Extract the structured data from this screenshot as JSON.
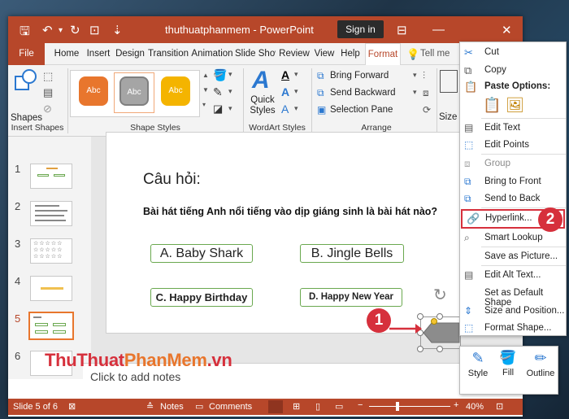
{
  "window": {
    "title": "thuthuatphanmem  -  PowerPoint",
    "sign_in": "Sign in"
  },
  "tabs": [
    "File",
    "Home",
    "Insert",
    "Design",
    "Transition",
    "Animation",
    "Slide Show",
    "Review",
    "View",
    "Help",
    "Format"
  ],
  "tell_me": "Tell me",
  "ribbon": {
    "shapes_label": "Shapes",
    "insert_shapes_group": "Insert Shapes",
    "style_swatch_text": "Abc",
    "shape_styles_group": "Shape Styles",
    "quick_styles_label": "Quick Styles",
    "wordart_group": "WordArt Styles",
    "bring_forward": "Bring Forward",
    "send_backward": "Send Backward",
    "selection_pane": "Selection Pane",
    "arrange_group": "Arrange",
    "size_label": "Size"
  },
  "thumbnails": [
    "1",
    "2",
    "3",
    "4",
    "5",
    "6"
  ],
  "slide": {
    "heading": "Câu hỏi:",
    "question": "Bài hát tiếng Anh nổi tiếng vào dịp giáng sinh là bài hát nào?",
    "answer_a": "A. Baby Shark",
    "answer_b": "B. Jingle Bells",
    "answer_c": "C. Happy Birthday",
    "answer_d": "D. Happy New Year"
  },
  "notes_placeholder": "Click to add notes",
  "status": {
    "slide_counter": "Slide 5 of 6",
    "notes": "Notes",
    "comments": "Comments",
    "zoom": "40%"
  },
  "context_menu": {
    "items": [
      {
        "label": "Cut",
        "disabled": false
      },
      {
        "label": "Copy",
        "disabled": false
      },
      {
        "label": "Paste Options:",
        "disabled": false
      },
      {
        "label": "Edit Text",
        "disabled": false
      },
      {
        "label": "Edit Points",
        "disabled": false
      },
      {
        "label": "Group",
        "disabled": true
      },
      {
        "label": "Bring to Front",
        "disabled": false
      },
      {
        "label": "Send to Back",
        "disabled": false
      },
      {
        "label": "Hyperlink...",
        "disabled": false
      },
      {
        "label": "Smart Lookup",
        "disabled": false
      },
      {
        "label": "Save as Picture...",
        "disabled": false
      },
      {
        "label": "Edit Alt Text...",
        "disabled": false
      },
      {
        "label": "Set as Default Shape",
        "disabled": false
      },
      {
        "label": "Size and Position...",
        "disabled": false
      },
      {
        "label": "Format Shape...",
        "disabled": false
      }
    ]
  },
  "mini_toolbar": {
    "style": "Style",
    "fill": "Fill",
    "outline": "Outline"
  },
  "callouts": {
    "step1": "1",
    "step2": "2"
  },
  "watermark": {
    "part1": "ThuThuat",
    "part2": "PhanMem",
    ".vn": ".vn"
  },
  "colors": {
    "accent": "#b7472a",
    "badge": "#d6303c",
    "answer_border": "#6aa84f",
    "selected_shape": "#7f7f7f"
  }
}
